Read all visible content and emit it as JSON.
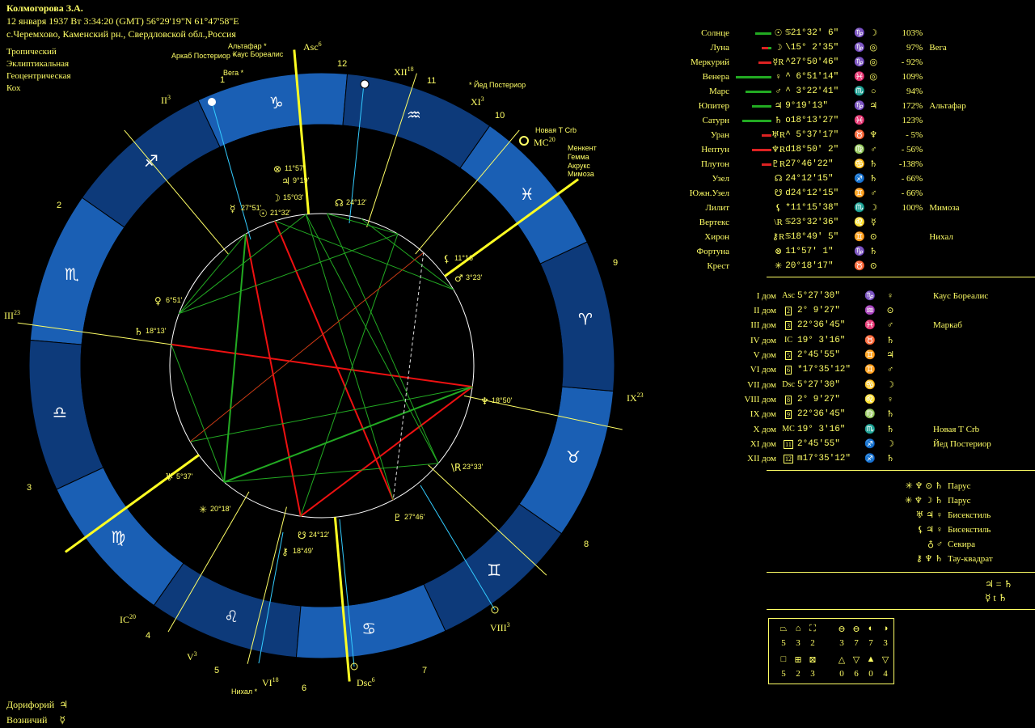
{
  "header": {
    "name": "Колмогорова З.А.",
    "line2": "12 января 1937  Вт   3:34:20 (GMT) 56°29'19\"N  61°47'58\"E",
    "line3": "с.Черемхово, Каменский рн., Свердловской обл.,Россия"
  },
  "system": [
    "Тропический",
    "Эклиптикальная",
    "Геоцентрическая",
    "Кох"
  ],
  "bottom_stars": [
    {
      "name": "Дорифорий",
      "glyph": "♃"
    },
    {
      "name": "Возничий",
      "glyph": "☿"
    }
  ],
  "planets": [
    {
      "name": "Солнце",
      "bar_color": "#22aa22",
      "bar_w": 20,
      "bar_color2": "",
      "bar_w2": 0,
      "sym": "☉",
      "pos": "♋21°32' 6\"",
      "sign": "♑",
      "ruler": "☽",
      "dig": "",
      "pct": "103%",
      "star": ""
    },
    {
      "name": "Луна",
      "bar_color": "#dd2222",
      "bar_w": 8,
      "bar_color2": "#22aa22",
      "bar_w2": 4,
      "sym": "☽",
      "pos": "\\15° 2'35\"",
      "sign": "♑",
      "ruler": "◎",
      "dig": "",
      "pct": "97%",
      "star": "Вега"
    },
    {
      "name": "Меркурий",
      "bar_color": "#dd2222",
      "bar_w": 16,
      "bar_color2": "",
      "bar_w2": 0,
      "sym": "☿R",
      "pos": "^27°50'46\"",
      "sign": "♑",
      "ruler": "◎",
      "dig": "",
      "pct": "- 92%",
      "star": ""
    },
    {
      "name": "Венера",
      "bar_color": "#22aa22",
      "bar_w": 44,
      "bar_color2": "",
      "bar_w2": 0,
      "sym": "♀",
      "pos": "^ 6°51'14\"",
      "sign": "♓",
      "ruler": "◎",
      "dig": "",
      "pct": "109%",
      "star": ""
    },
    {
      "name": "Марс",
      "bar_color": "#22aa22",
      "bar_w": 32,
      "bar_color2": "",
      "bar_w2": 0,
      "sym": "♂",
      "pos": "^ 3°22'41\"",
      "sign": "♏",
      "ruler": "○",
      "dig": "",
      "pct": "94%",
      "star": ""
    },
    {
      "name": "Юпитер",
      "bar_color": "#22aa22",
      "bar_w": 24,
      "bar_color2": "",
      "bar_w2": 0,
      "sym": "♃",
      "pos": "  9°19'13\"",
      "sign": "♑",
      "ruler": "♃",
      "dig": "",
      "pct": "172%",
      "star": "Альтафар"
    },
    {
      "name": "Сатурн",
      "bar_color": "#22aa22",
      "bar_w": 36,
      "bar_color2": "",
      "bar_w2": 0,
      "sym": "♄",
      "pos": "o18°13'27\"",
      "sign": "♓",
      "ruler": "",
      "dig": "",
      "pct": "123%",
      "star": ""
    },
    {
      "name": "Уран",
      "bar_color": "#dd2222",
      "bar_w": 12,
      "bar_color2": "",
      "bar_w2": 0,
      "sym": "♅R",
      "pos": "^ 5°37'17\"",
      "sign": "♉",
      "ruler": "♆",
      "dig": "",
      "pct": "-  5%",
      "star": ""
    },
    {
      "name": "Нептун",
      "bar_color": "#dd2222",
      "bar_w": 24,
      "bar_color2": "",
      "bar_w2": 0,
      "sym": "♆R",
      "pos": "d18°50' 2\"",
      "sign": "♍",
      "ruler": "♂",
      "dig": "",
      "pct": "- 56%",
      "star": ""
    },
    {
      "name": "Плутон",
      "bar_color": "#dd2222",
      "bar_w": 12,
      "bar_color2": "",
      "bar_w2": 0,
      "sym": "♇R",
      "pos": " 27°46'22\"",
      "sign": "♋",
      "ruler": "♄",
      "dig": "",
      "pct": "-138%",
      "star": ""
    },
    {
      "name": "Узел",
      "bar_color": "",
      "bar_w": 0,
      "bar_color2": "",
      "bar_w2": 0,
      "sym": "☊",
      "pos": " 24°12'15\"",
      "sign": "♐",
      "ruler": "♄",
      "dig": "",
      "pct": "- 66%",
      "star": ""
    },
    {
      "name": "Южн.Узел",
      "bar_color": "",
      "bar_w": 0,
      "bar_color2": "",
      "bar_w2": 0,
      "sym": "☋",
      "pos": "d24°12'15\"",
      "sign": "♊",
      "ruler": "♂",
      "dig": "",
      "pct": "- 66%",
      "star": ""
    },
    {
      "name": "Лилит",
      "bar_color": "",
      "bar_w": 0,
      "bar_color2": "",
      "bar_w2": 0,
      "sym": "⚸",
      "pos": "*11°15'38\"",
      "sign": "♏",
      "ruler": "☽",
      "dig": "",
      "pct": "100%",
      "star": "Мимоза"
    },
    {
      "name": "Вертекс",
      "bar_color": "",
      "bar_w": 0,
      "bar_color2": "",
      "bar_w2": 0,
      "sym": "\\R",
      "pos": "♋23°32'36\"",
      "sign": "♌",
      "ruler": "☿",
      "dig": "",
      "pct": "",
      "star": ""
    },
    {
      "name": "Хирон",
      "bar_color": "",
      "bar_w": 0,
      "bar_color2": "",
      "bar_w2": 0,
      "sym": "⚷R",
      "pos": "♋18°49' 5\"",
      "sign": "♊",
      "ruler": "⊙",
      "dig": "",
      "pct": "",
      "star": "Нихал"
    },
    {
      "name": "Фортуна",
      "bar_color": "",
      "bar_w": 0,
      "bar_color2": "",
      "bar_w2": 0,
      "sym": "⊗",
      "pos": " 11°57' 1\"",
      "sign": "♑",
      "ruler": "♄",
      "dig": "",
      "pct": "",
      "star": ""
    },
    {
      "name": "Крест",
      "bar_color": "",
      "bar_w": 0,
      "bar_color2": "",
      "bar_w2": 0,
      "sym": "✳",
      "pos": " 20°18'17\"",
      "sign": "♉",
      "ruler": "⊙",
      "dig": "",
      "pct": "",
      "star": ""
    }
  ],
  "houses": [
    {
      "name": "I дом",
      "sym": "Asc",
      "pos": " 5°27'30\"",
      "sign": "♑",
      "ruler": "♀",
      "star": "Каус Бореалис"
    },
    {
      "name": "II дом",
      "sym": "2",
      "pos": " 2° 9'27\"",
      "sign": "♒",
      "ruler": "⊙",
      "star": ""
    },
    {
      "name": "III дом",
      "sym": "3",
      "pos": "22°36'45\"",
      "sign": "♓",
      "ruler": "♂",
      "star": "Маркаб"
    },
    {
      "name": "IV дом",
      "sym": "IC",
      "pos": "19° 3'16\"",
      "sign": "♉",
      "ruler": "♄",
      "star": ""
    },
    {
      "name": "V дом",
      "sym": "5",
      "pos": " 2°45'55\"",
      "sign": "♊",
      "ruler": "♃",
      "star": ""
    },
    {
      "name": "VI дом",
      "sym": "6",
      "pos": "*17°35'12\"",
      "sign": "♊",
      "ruler": "♂",
      "star": ""
    },
    {
      "name": "VII дом",
      "sym": "Dsc",
      "pos": " 5°27'30\"",
      "sign": "♋",
      "ruler": "☽",
      "star": ""
    },
    {
      "name": "VIII дом",
      "sym": "8",
      "pos": " 2° 9'27\"",
      "sign": "♌",
      "ruler": "♀",
      "star": ""
    },
    {
      "name": "IX дом",
      "sym": "9",
      "pos": "22°36'45\"",
      "sign": "♍",
      "ruler": "♄",
      "star": ""
    },
    {
      "name": "X дом",
      "sym": "MC",
      "pos": "19° 3'16\"",
      "sign": "♏",
      "ruler": "♄",
      "star": "Новая Т Сrb"
    },
    {
      "name": "XI дом",
      "sym": "11",
      "pos": " 2°45'55\"",
      "sign": "♐",
      "ruler": "☽",
      "star": "Йед Постериор"
    },
    {
      "name": "XII дом",
      "sym": "12",
      "pos": "m17°35'12\"",
      "sign": "♐",
      "ruler": "♄",
      "star": ""
    }
  ],
  "configurations": [
    {
      "syms": "✳ ♆ ⊙ ♄",
      "name": "Парус"
    },
    {
      "syms": "✳ ♆ ☽ ♄",
      "name": "Парус"
    },
    {
      "syms": "♅ ♃ ♀",
      "name": "Бисекстиль"
    },
    {
      "syms": "⚸ ♃ ♀",
      "name": "Бисекстиль"
    },
    {
      "syms": "♁ ♂",
      "name": "Секира"
    },
    {
      "syms": "⚷ ♆ ♄",
      "name": "Тау-квадрат"
    }
  ],
  "equalities": [
    "♃ = ♄",
    "☿ t ♄"
  ],
  "stats": {
    "row1_syms": [
      "⏢",
      "⌂",
      "⛶",
      "⊖",
      "⊖",
      "◐",
      "◑"
    ],
    "row1_vals": [
      "5",
      "3",
      "2",
      "3",
      "7",
      "7",
      "3"
    ],
    "row2_syms": [
      "□",
      "⊞",
      "⊠",
      "△",
      "▽",
      "▲",
      "▽"
    ],
    "row2_vals": [
      "5",
      "2",
      "3",
      "0",
      "6",
      "0",
      "4"
    ]
  },
  "wheel": {
    "signs": [
      "♑",
      "♐",
      "♏",
      "♎",
      "♍",
      "♌",
      "♋",
      "♊",
      "♉",
      "♈",
      "♓",
      "♒"
    ],
    "house_labels": [
      {
        "text": "Asc",
        "sup": "6"
      },
      {
        "text": "XII",
        "sup": "18"
      },
      {
        "text": "XI",
        "sup": "3"
      },
      {
        "text": "MC",
        "sup": "20"
      },
      {
        "text": "IX",
        "sup": "23"
      },
      {
        "text": "VIII",
        "sup": "3"
      },
      {
        "text": "Dsc",
        "sup": "6"
      },
      {
        "text": "VI",
        "sup": "18"
      },
      {
        "text": "V",
        "sup": "3"
      },
      {
        "text": "IC",
        "sup": "20"
      },
      {
        "text": "III",
        "sup": "23"
      },
      {
        "text": "II",
        "sup": "3"
      }
    ],
    "house_numbers": [
      "1",
      "12",
      "11",
      "10",
      "9",
      "8",
      "7",
      "6",
      "5",
      "4",
      "3",
      "2"
    ],
    "stars": [
      {
        "text": "Альтафар *"
      },
      {
        "text": "Каус Бореалис"
      },
      {
        "text": "Аркаб Постериор *"
      },
      {
        "text": "Вега *"
      },
      {
        "text": "* Йед Постериор"
      },
      {
        "text": "Новая Т Сrb"
      },
      {
        "text": "Менкент"
      },
      {
        "text": "Гемма"
      },
      {
        "text": "Акрукс"
      },
      {
        "text": "Мимоза"
      },
      {
        "text": "Нихал *"
      }
    ],
    "planet_labels": [
      {
        "text": "11°57'"
      },
      {
        "text": "9°19'"
      },
      {
        "text": "15°03'"
      },
      {
        "text": "21°32'"
      },
      {
        "text": "27°51'"
      },
      {
        "text": "24°12'"
      },
      {
        "text": "11°16'"
      },
      {
        "text": "3°23'"
      },
      {
        "text": "6°51'"
      },
      {
        "text": "18°13'"
      },
      {
        "text": "18°50'"
      },
      {
        "text": "23°33'"
      },
      {
        "text": "27°46'"
      },
      {
        "text": "24°12'"
      },
      {
        "text": "18°49'"
      },
      {
        "text": "20°18'"
      },
      {
        "text": "5°37'"
      }
    ],
    "colors": {
      "ring": "#1a5fb4",
      "ring_dark": "#0d3a7a",
      "aspect_red": "#ee1111",
      "aspect_green": "#22aa22",
      "axis": "#ffff22",
      "cusp": "#ffff66",
      "star_line": "#33ccff"
    }
  }
}
